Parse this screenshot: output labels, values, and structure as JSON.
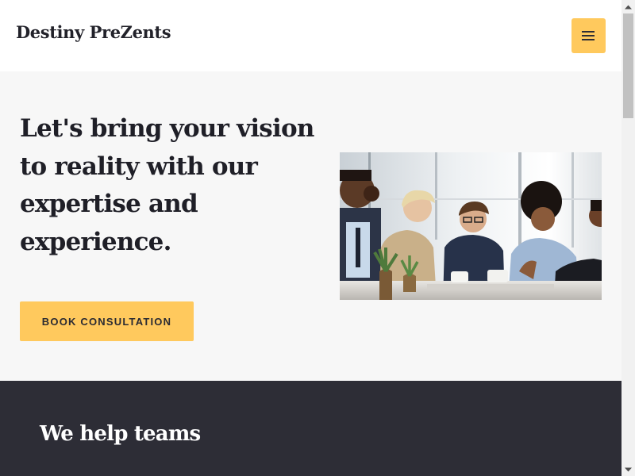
{
  "header": {
    "brand": "Destiny PreZents",
    "menu_icon": "hamburger-menu-icon",
    "accent_color": "#ffc95d"
  },
  "hero": {
    "title": "Let's bring your vision to reality with our expertise and experience.",
    "cta_label": "BOOK CONSULTATION",
    "image_icon": "team-meeting-photo",
    "background_color": "#f7f7f7"
  },
  "section": {
    "heading": "We help teams",
    "background_color": "#2d2d36"
  },
  "scrollbar": {
    "up_icon": "scroll-up-arrow-icon",
    "down_icon": "scroll-down-arrow-icon"
  }
}
